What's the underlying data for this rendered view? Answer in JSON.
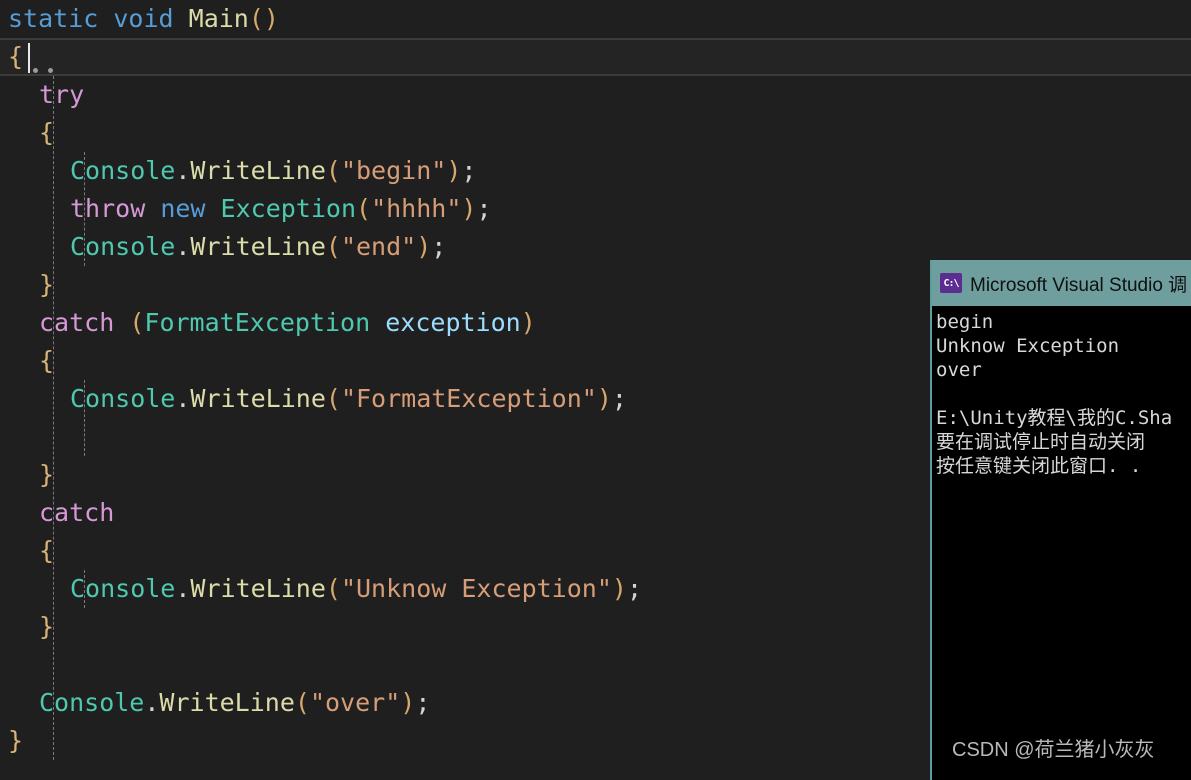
{
  "editor": {
    "background_color": "#1f1f1f",
    "lines": [
      {
        "indent": 0,
        "tokens": [
          {
            "t": "static",
            "c": "kw"
          },
          {
            "t": " ",
            "c": "punct"
          },
          {
            "t": "void",
            "c": "kw"
          },
          {
            "t": " ",
            "c": "punct"
          },
          {
            "t": "Main",
            "c": "method"
          },
          {
            "t": "()",
            "c": "paren"
          }
        ]
      },
      {
        "indent": 0,
        "current": true,
        "tokens": [
          {
            "t": "{",
            "c": "brace"
          }
        ]
      },
      {
        "indent": 1,
        "tokens": [
          {
            "t": "try",
            "c": "kwctl"
          }
        ]
      },
      {
        "indent": 1,
        "tokens": [
          {
            "t": "{",
            "c": "brace"
          }
        ]
      },
      {
        "indent": 2,
        "tokens": [
          {
            "t": "Console",
            "c": "type"
          },
          {
            "t": ".",
            "c": "punct"
          },
          {
            "t": "WriteLine",
            "c": "method"
          },
          {
            "t": "(",
            "c": "paren"
          },
          {
            "t": "\"begin\"",
            "c": "str"
          },
          {
            "t": ")",
            "c": "paren"
          },
          {
            "t": ";",
            "c": "punct"
          }
        ]
      },
      {
        "indent": 2,
        "tokens": [
          {
            "t": "throw",
            "c": "kwctl"
          },
          {
            "t": " ",
            "c": "punct"
          },
          {
            "t": "new",
            "c": "kw"
          },
          {
            "t": " ",
            "c": "punct"
          },
          {
            "t": "Exception",
            "c": "type"
          },
          {
            "t": "(",
            "c": "paren"
          },
          {
            "t": "\"hhhh\"",
            "c": "str"
          },
          {
            "t": ")",
            "c": "paren"
          },
          {
            "t": ";",
            "c": "punct"
          }
        ]
      },
      {
        "indent": 2,
        "tokens": [
          {
            "t": "Console",
            "c": "type"
          },
          {
            "t": ".",
            "c": "punct"
          },
          {
            "t": "WriteLine",
            "c": "method"
          },
          {
            "t": "(",
            "c": "paren"
          },
          {
            "t": "\"end\"",
            "c": "str"
          },
          {
            "t": ")",
            "c": "paren"
          },
          {
            "t": ";",
            "c": "punct"
          }
        ]
      },
      {
        "indent": 1,
        "tokens": [
          {
            "t": "}",
            "c": "brace"
          }
        ]
      },
      {
        "indent": 1,
        "tokens": [
          {
            "t": "catch",
            "c": "kwctl"
          },
          {
            "t": " ",
            "c": "punct"
          },
          {
            "t": "(",
            "c": "paren"
          },
          {
            "t": "FormatException",
            "c": "type"
          },
          {
            "t": " ",
            "c": "punct"
          },
          {
            "t": "exception",
            "c": "ident"
          },
          {
            "t": ")",
            "c": "paren"
          }
        ]
      },
      {
        "indent": 1,
        "tokens": [
          {
            "t": "{",
            "c": "brace"
          }
        ]
      },
      {
        "indent": 2,
        "tokens": [
          {
            "t": "Console",
            "c": "type"
          },
          {
            "t": ".",
            "c": "punct"
          },
          {
            "t": "WriteLine",
            "c": "method"
          },
          {
            "t": "(",
            "c": "paren"
          },
          {
            "t": "\"FormatException\"",
            "c": "str"
          },
          {
            "t": ")",
            "c": "paren"
          },
          {
            "t": ";",
            "c": "punct"
          }
        ]
      },
      {
        "indent": 2,
        "tokens": []
      },
      {
        "indent": 1,
        "tokens": [
          {
            "t": "}",
            "c": "brace"
          }
        ]
      },
      {
        "indent": 1,
        "tokens": [
          {
            "t": "catch",
            "c": "kwctl"
          }
        ]
      },
      {
        "indent": 1,
        "tokens": [
          {
            "t": "{",
            "c": "brace"
          }
        ]
      },
      {
        "indent": 2,
        "tokens": [
          {
            "t": "Console",
            "c": "type"
          },
          {
            "t": ".",
            "c": "punct"
          },
          {
            "t": "WriteLine",
            "c": "method"
          },
          {
            "t": "(",
            "c": "paren"
          },
          {
            "t": "\"Unknow Exception\"",
            "c": "str"
          },
          {
            "t": ")",
            "c": "paren"
          },
          {
            "t": ";",
            "c": "punct"
          }
        ]
      },
      {
        "indent": 1,
        "tokens": [
          {
            "t": "}",
            "c": "brace"
          }
        ]
      },
      {
        "indent": 1,
        "tokens": []
      },
      {
        "indent": 1,
        "tokens": [
          {
            "t": "Console",
            "c": "type"
          },
          {
            "t": ".",
            "c": "punct"
          },
          {
            "t": "WriteLine",
            "c": "method"
          },
          {
            "t": "(",
            "c": "paren"
          },
          {
            "t": "\"over\"",
            "c": "str"
          },
          {
            "t": ")",
            "c": "paren"
          },
          {
            "t": ";",
            "c": "punct"
          }
        ]
      },
      {
        "indent": 0,
        "tokens": [
          {
            "t": "}",
            "c": "brace"
          }
        ]
      }
    ]
  },
  "console_window": {
    "title": "Microsoft Visual Studio 调",
    "icon": "console-cmd-icon",
    "icon_glyph": "C:\\",
    "titlebar_color": "#6f9e9e",
    "background_color": "#000000",
    "output_lines": [
      "begin",
      "Unknow Exception",
      "over",
      "",
      "E:\\Unity教程\\我的C.Sha",
      "要在调试停止时自动关闭",
      "按任意键关闭此窗口. ."
    ]
  },
  "watermark": {
    "text": "CSDN @荷兰猪小灰灰"
  }
}
